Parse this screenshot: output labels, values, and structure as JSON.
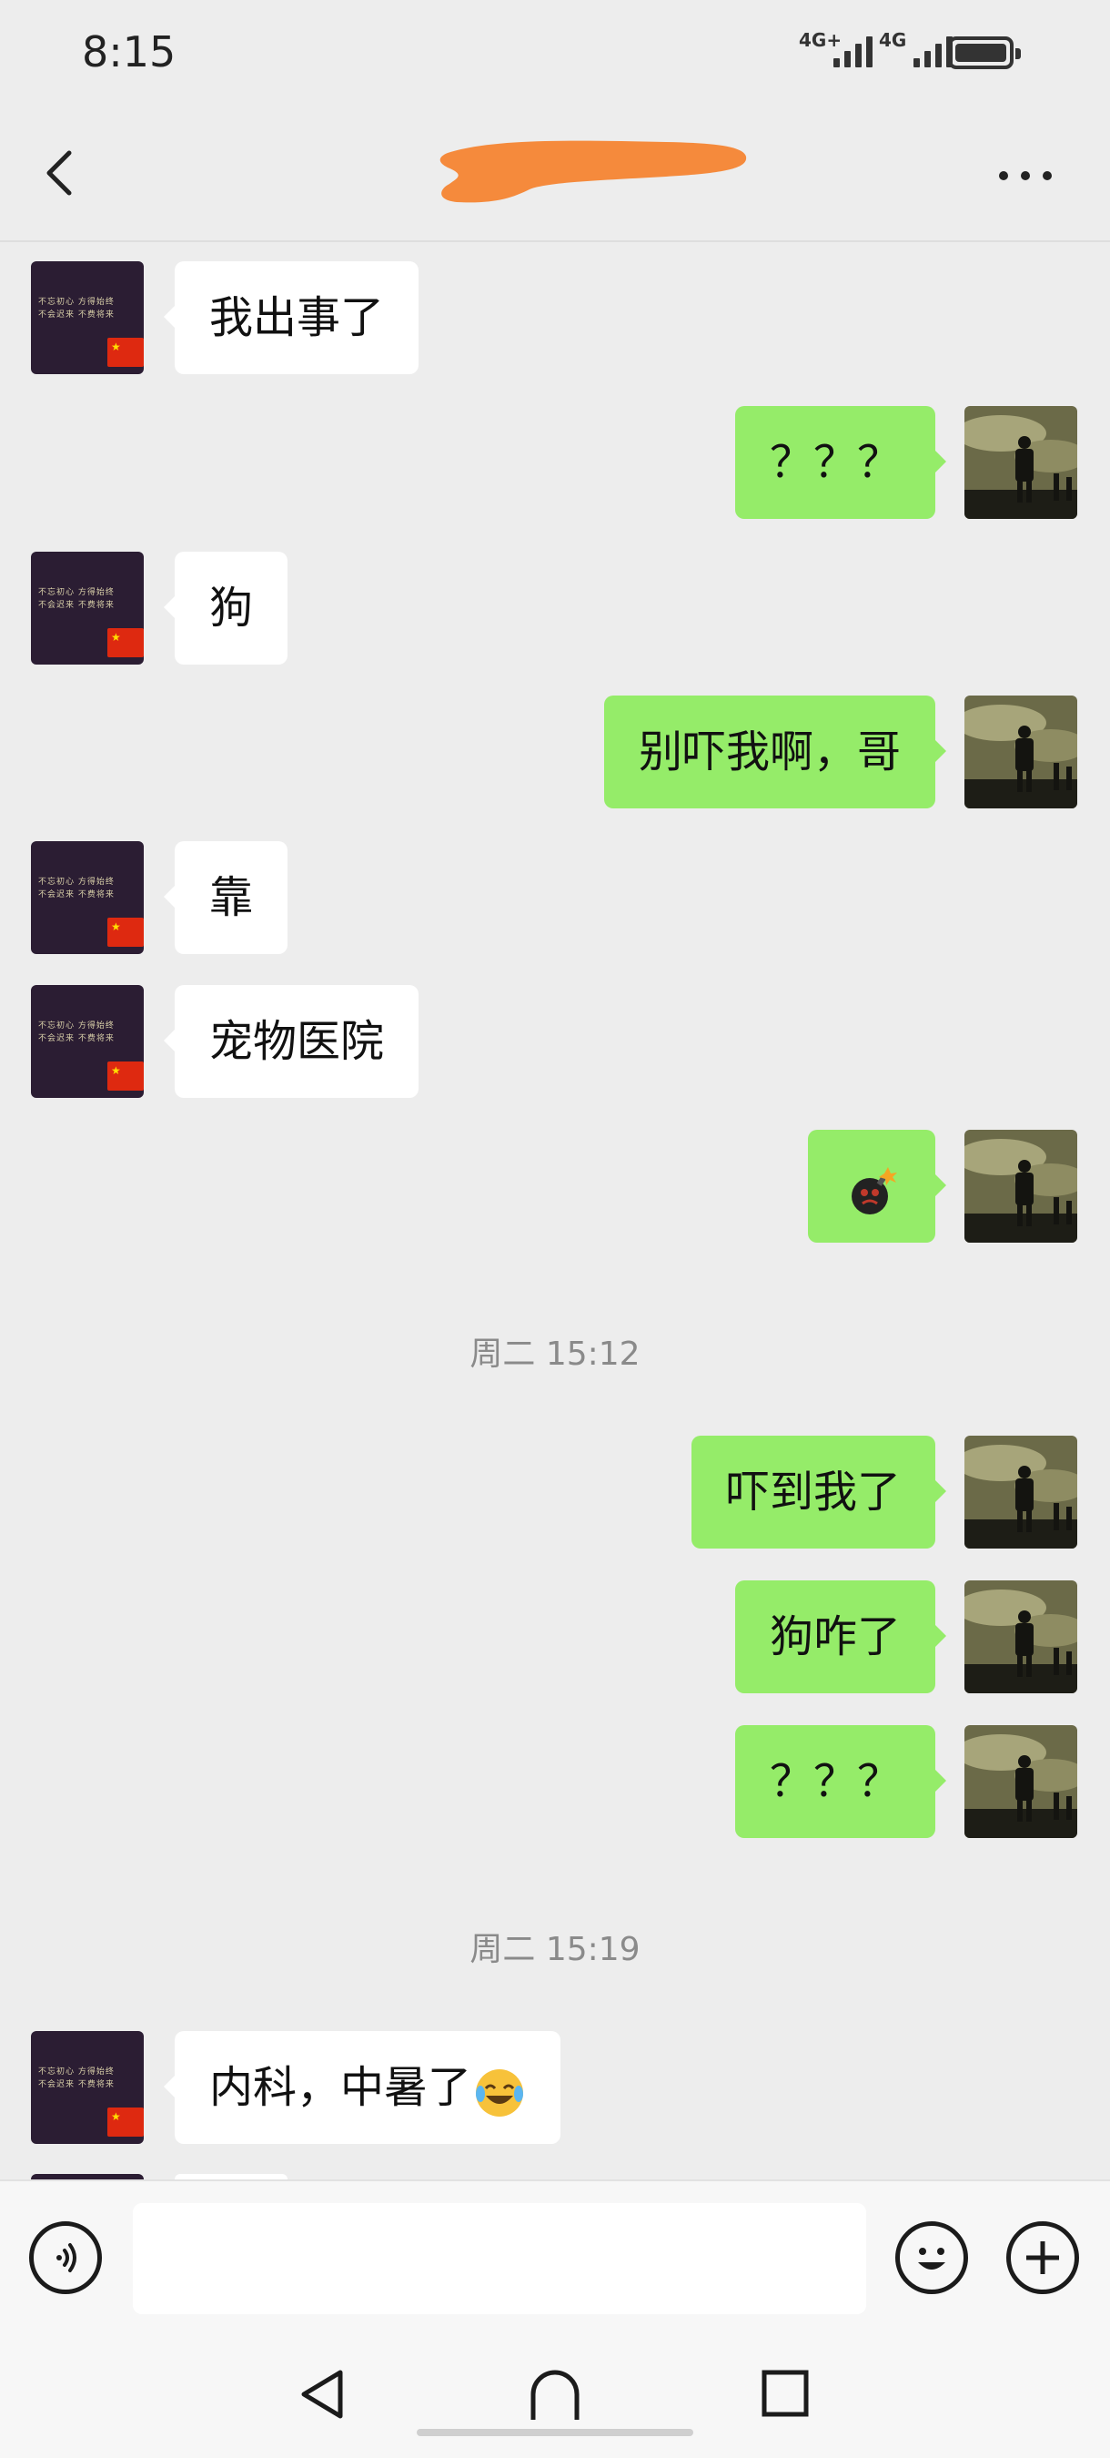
{
  "status_bar": {
    "time": "8:15",
    "signal_1_label": "4G+",
    "signal_2_label": "4G",
    "battery_icon": "battery-icon"
  },
  "header": {
    "contact_name_redacted": true,
    "back_icon": "chevron-left-icon",
    "more_icon": "more-dots-icon"
  },
  "messages": [
    {
      "side": "left",
      "text": "我出事了"
    },
    {
      "side": "right",
      "text": "？？？"
    },
    {
      "side": "left",
      "text": "狗"
    },
    {
      "side": "right",
      "text": "别吓我啊，哥"
    },
    {
      "side": "left",
      "text": "靠"
    },
    {
      "side": "left",
      "text": "宠物医院"
    },
    {
      "side": "right",
      "text": "",
      "sticker": "bomb-emoji"
    },
    {
      "side": "right",
      "text": "吓到我了"
    },
    {
      "side": "right",
      "text": "狗咋了"
    },
    {
      "side": "right",
      "text": "？？？"
    },
    {
      "side": "left",
      "text": "内科，中暑了",
      "emoji": "laughing-crying-emoji"
    }
  ],
  "timestamps": [
    "周二 15:12",
    "周二 15:19"
  ],
  "avatar_text": {
    "left_line1": "不忘初心 方得始终",
    "left_line2": "不会迟来 不费将来"
  },
  "input_bar": {
    "text_value": "",
    "voice_icon": "voice-icon",
    "emoji_icon": "smiley-icon",
    "plus_icon": "plus-icon"
  },
  "nav_bar": {
    "back_icon": "triangle-back-icon",
    "home_icon": "home-icon",
    "recents_icon": "square-recents-icon"
  },
  "colors": {
    "background": "#ededed",
    "sent_bubble": "#95ec69",
    "received_bubble": "#ffffff",
    "redaction": "#f58a3c"
  }
}
